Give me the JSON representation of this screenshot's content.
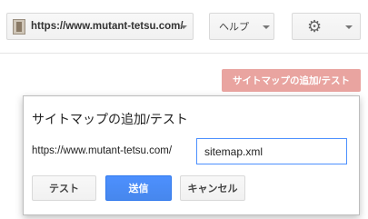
{
  "header": {
    "site_url": "https://www.mutant-tetsu.com/",
    "help_label": "ヘルプ",
    "settings_icon": "gear-icon"
  },
  "toolbar": {
    "add_sitemap_label": "サイトマップの追加/テスト"
  },
  "dialog": {
    "title": "サイトマップの追加/テスト",
    "url_prefix": "https://www.mutant-tetsu.com/",
    "sitemap_value": "sitemap.xml",
    "test_label": "テスト",
    "submit_label": "送信",
    "cancel_label": "キャンセル"
  },
  "colors": {
    "primary_blue": "#4d90fe",
    "add_button_pink": "#e9a4a0"
  }
}
